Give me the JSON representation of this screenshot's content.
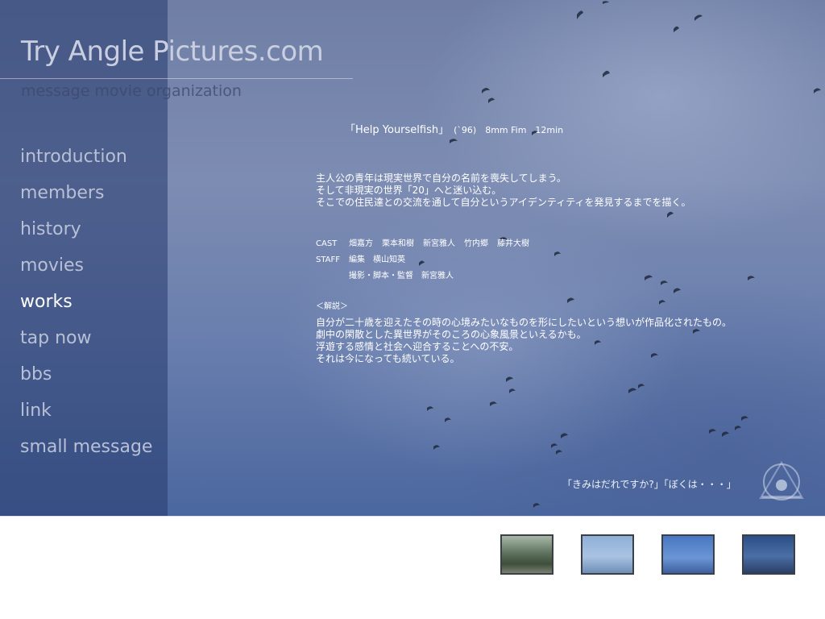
{
  "site": {
    "title": "Try Angle Pictures.com",
    "subtitle": "message movie organization"
  },
  "nav": {
    "items": [
      {
        "label": "introduction",
        "active": false
      },
      {
        "label": "members",
        "active": false
      },
      {
        "label": "history",
        "active": false
      },
      {
        "label": "movies",
        "active": false
      },
      {
        "label": "works",
        "active": true
      },
      {
        "label": "tap now",
        "active": false
      },
      {
        "label": "bbs",
        "active": false
      },
      {
        "label": "link",
        "active": false
      },
      {
        "label": "small message",
        "active": false
      }
    ]
  },
  "work": {
    "title": "「Help Yourselfish」",
    "meta": "(`96)　8mm Fim　12min",
    "synopsis": [
      "主人公の青年は現実世界で自分の名前を喪失してしまう。",
      "そして非現実の世界「20」へと迷い込む。",
      "そこでの住民達との交流を通して自分というアイデンティティを発見するまでを描く。"
    ],
    "cast_label": "CAST",
    "cast": [
      "畑嘉方",
      "栗本和樹",
      "新宮雅人",
      "竹内郷",
      "藤井大樹"
    ],
    "staff_label": "STAFF",
    "staff": [
      "編集　横山知英",
      "撮影・脚本・監督　新宮雅人"
    ],
    "commentary_heading": "＜解説＞",
    "commentary": [
      "自分が二十歳を迎えたその時の心境みたいなものを形にしたいという想いが作品化されたもの。",
      "劇中の閑散とした異世界がそのころの心象風景といえるかも。",
      "浮遊する感情と社会へ迎合することへの不安。",
      "それは今になっても続いている。"
    ]
  },
  "quote": "「きみはだれですか?」「ぼくは・・・」",
  "colors": {
    "sidebar": "#263a6e",
    "active_nav": "#ffffff",
    "inactive_nav": "#b8c0d6",
    "sky": "#6f7ea5"
  }
}
